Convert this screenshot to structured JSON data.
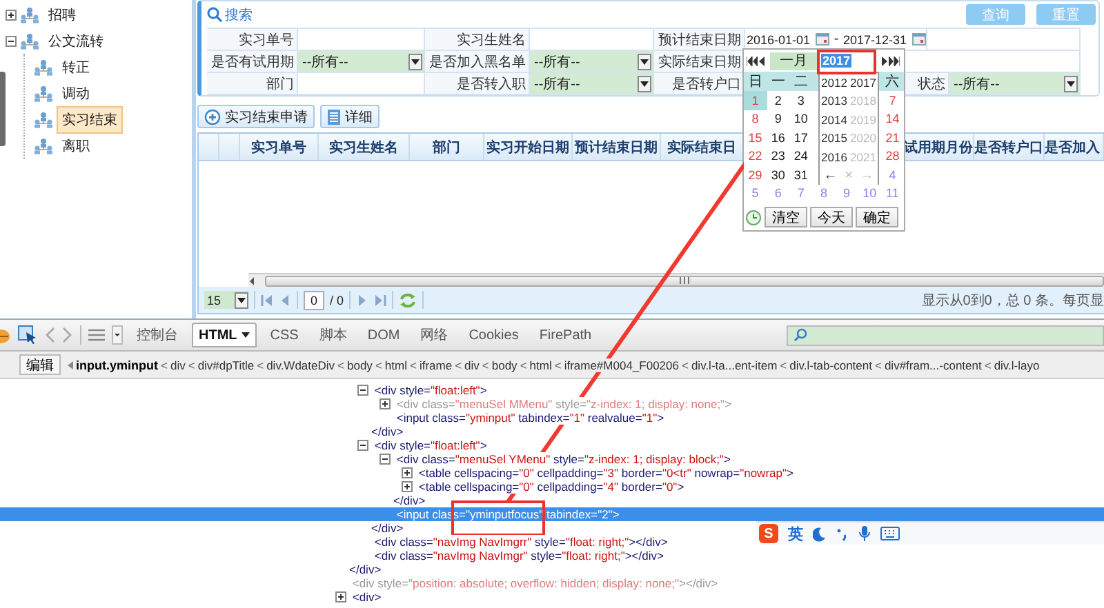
{
  "sidebar": {
    "tree": [
      {
        "label": "招聘",
        "expanded": false,
        "selected": false
      },
      {
        "label": "公文流转",
        "expanded": true,
        "selected": false,
        "children": [
          {
            "label": "转正",
            "selected": false
          },
          {
            "label": "调动",
            "selected": false
          },
          {
            "label": "实习结束",
            "selected": true
          },
          {
            "label": "离职",
            "selected": false
          }
        ]
      }
    ]
  },
  "search_panel": {
    "title": "搜索",
    "buttons": [
      "查询",
      "重置"
    ],
    "rows": [
      [
        {
          "kind": "label",
          "text": "实习单号"
        },
        {
          "kind": "input"
        },
        {
          "kind": "label",
          "text": "实习生姓名"
        },
        {
          "kind": "input"
        },
        {
          "kind": "label",
          "text": "预计结束日期"
        },
        {
          "kind": "date_range",
          "from": "2016-01-01",
          "separator": "-",
          "to": "2017-12-31"
        }
      ],
      [
        {
          "kind": "label",
          "text": "是否有试用期"
        },
        {
          "kind": "select",
          "value": "--所有--"
        },
        {
          "kind": "label",
          "text": "是否加入黑名单"
        },
        {
          "kind": "select",
          "value": "--所有--"
        },
        {
          "kind": "label",
          "text": "实际结束日期"
        },
        {
          "kind": "input"
        }
      ],
      [
        {
          "kind": "label",
          "text": "部门"
        },
        {
          "kind": "input"
        },
        {
          "kind": "label",
          "text": "是否转入职"
        },
        {
          "kind": "select",
          "value": "--所有--"
        },
        {
          "kind": "label",
          "text": "是否转户口"
        },
        {
          "kind": "select"
        },
        {
          "kind": "label",
          "text": "状态"
        },
        {
          "kind": "select",
          "value": "--所有--"
        }
      ]
    ]
  },
  "toolbar": {
    "buttons": [
      {
        "kind": "add",
        "label": "实习结束申请"
      },
      {
        "kind": "detail",
        "label": "详细"
      }
    ]
  },
  "grid": {
    "columns": [
      "实习单号",
      "实习生姓名",
      "部门",
      "实习开始日期",
      "预计结束日期",
      "实际结束日",
      "试用期月份",
      "是否转户口",
      "是否加入"
    ]
  },
  "pager": {
    "page_size": "15",
    "page": "0",
    "total_pages": "/ 0",
    "summary": "显示从0到0，总 0 条。每页显"
  },
  "calendar": {
    "month": "一月",
    "year": "2017",
    "weekdays": {
      "left": [
        "日",
        "一",
        "二"
      ],
      "right": [
        "六"
      ]
    },
    "weeks": [
      {
        "left": [
          {
            "text": "1",
            "selected": true,
            "other_month": false
          },
          {
            "text": "2",
            "selected": false,
            "other_month": false
          },
          {
            "text": "3",
            "selected": false,
            "other_month": false
          }
        ],
        "right": [
          {
            "text": "7",
            "selected": false,
            "other_month": false
          }
        ]
      },
      {
        "left": [
          {
            "text": "8",
            "selected": false,
            "other_month": false
          },
          {
            "text": "9",
            "selected": false,
            "other_month": false
          },
          {
            "text": "10",
            "selected": false,
            "other_month": false
          }
        ],
        "right": [
          {
            "text": "14",
            "selected": false,
            "other_month": false
          }
        ]
      },
      {
        "left": [
          {
            "text": "15",
            "selected": false,
            "other_month": false
          },
          {
            "text": "16",
            "selected": false,
            "other_month": false
          },
          {
            "text": "17",
            "selected": false,
            "other_month": false
          }
        ],
        "right": [
          {
            "text": "21",
            "selected": false,
            "other_month": false
          }
        ]
      },
      {
        "left": [
          {
            "text": "22",
            "selected": false,
            "other_month": false
          },
          {
            "text": "23",
            "selected": false,
            "other_month": false
          },
          {
            "text": "24",
            "selected": false,
            "other_month": false
          }
        ],
        "right": [
          {
            "text": "28",
            "selected": false,
            "other_month": false
          }
        ]
      },
      {
        "left": [
          {
            "text": "29",
            "selected": false,
            "other_month": false
          },
          {
            "text": "30",
            "selected": false,
            "other_month": false
          },
          {
            "text": "31",
            "selected": false,
            "other_month": false
          }
        ],
        "right": [
          {
            "text": "4",
            "selected": false,
            "other_month": true
          }
        ]
      },
      {
        "left": [
          {
            "text": "5",
            "selected": false,
            "other_month": true
          },
          {
            "text": "6",
            "selected": false,
            "other_month": true
          },
          {
            "text": "7",
            "selected": false,
            "other_month": true
          },
          {
            "text": "8",
            "selected": false,
            "other_month": true
          },
          {
            "text": "9",
            "selected": false,
            "other_month": true
          },
          {
            "text": "10",
            "selected": false,
            "other_month": true
          },
          {
            "text": "11",
            "selected": false,
            "other_month": true
          }
        ]
      }
    ],
    "buttons": [
      "清空",
      "今天",
      "确定"
    ],
    "year_menu": {
      "years": [
        {
          "text": "2012",
          "disabled": false
        },
        {
          "text": "2017",
          "disabled": false
        },
        {
          "text": "2013",
          "disabled": false
        },
        {
          "text": "2018",
          "disabled": true
        },
        {
          "text": "2014",
          "disabled": false
        },
        {
          "text": "2019",
          "disabled": true
        },
        {
          "text": "2015",
          "disabled": false
        },
        {
          "text": "2020",
          "disabled": true
        },
        {
          "text": "2016",
          "disabled": false
        },
        {
          "text": "2021",
          "disabled": true
        }
      ],
      "nav": [
        {
          "text": "←",
          "disabled": false
        },
        {
          "text": "×",
          "disabled": true
        },
        {
          "text": "→",
          "disabled": true
        }
      ]
    }
  },
  "devtools": {
    "tabs": [
      {
        "label": "控制台",
        "selected": false
      },
      {
        "label": "HTML",
        "selected": true
      },
      {
        "label": "CSS",
        "selected": false
      },
      {
        "label": "脚本",
        "selected": false
      },
      {
        "label": "DOM",
        "selected": false
      },
      {
        "label": "网络",
        "selected": false
      },
      {
        "label": "Cookies",
        "selected": false
      },
      {
        "label": "FirePath",
        "selected": false
      }
    ],
    "breadcrumb": {
      "action": "编辑",
      "separator": "<",
      "items": [
        {
          "text": "input.yminput",
          "selected": true
        },
        {
          "text": "div",
          "selected": false
        },
        {
          "text": "div#dpTitle",
          "selected": false
        },
        {
          "text": "div.WdateDiv",
          "selected": false
        },
        {
          "text": "body",
          "selected": false
        },
        {
          "text": "html",
          "selected": false
        },
        {
          "text": "iframe",
          "selected": false
        },
        {
          "text": "div",
          "selected": false
        },
        {
          "text": "body",
          "selected": false
        },
        {
          "text": "html",
          "selected": false
        },
        {
          "text": "iframe#M004_F00206",
          "selected": false
        },
        {
          "text": "div.l-ta...ent-item",
          "selected": false
        },
        {
          "text": "div.l-tab-content",
          "selected": false
        },
        {
          "text": "div#fram...-content",
          "selected": false
        },
        {
          "text": "div.l-layo",
          "selected": false
        }
      ]
    },
    "html_tree": [
      {
        "close": "</div>",
        "children": [
          {
            "open": "<div style=\"float:left\">",
            "expanded": true,
            "selected": false,
            "hidden": false,
            "close": "</div>",
            "children": [
              {
                "open": "<div class=\"menuSel MMenu\" style=\"z-index: 1; display: none;\">",
                "expanded": false,
                "selected": false,
                "hidden": true
              },
              {
                "open": "<input class=\"yminput\" tabindex=\"1\" realvalue=\"1\">",
                "selected": false,
                "hidden": false
              }
            ]
          },
          {
            "open": "<div style=\"float:left\">",
            "expanded": true,
            "selected": false,
            "hidden": false,
            "close": "</div>",
            "children": [
              {
                "open": "<div class=\"menuSel YMenu\" style=\"z-index: 1; display: block;\">",
                "expanded": true,
                "selected": false,
                "hidden": false,
                "close": "</div>",
                "children": [
                  {
                    "open": "<table cellspacing=\"0\" cellpadding=\"3\" border=\"0<tr\" nowrap=\"nowrap\">",
                    "expanded": false,
                    "selected": false,
                    "hidden": false
                  },
                  {
                    "open": "<table cellspacing=\"0\" cellpadding=\"4\" border=\"0\">",
                    "expanded": false,
                    "selected": false,
                    "hidden": false
                  }
                ]
              },
              {
                "open": "<input class=\"yminputfocus\" tabindex=\"2\">",
                "selected": true,
                "hidden": false
              }
            ]
          },
          {
            "open": "<div class=\"navImg NavImgrr\" style=\"float: right;\"></div>",
            "selected": false,
            "hidden": false
          },
          {
            "open": "<div class=\"navImg NavImgr\" style=\"float: right;\"></div>",
            "selected": false,
            "hidden": false
          }
        ]
      },
      {
        "open": "<div style=\"position: absolute; overflow: hidden; display: none;\"></div>",
        "selected": false,
        "hidden": true
      },
      {
        "open": "<div>",
        "expanded": false,
        "selected": false,
        "hidden": false
      }
    ]
  },
  "ime_toolbar": {
    "logo": "S",
    "mode": "英"
  }
}
